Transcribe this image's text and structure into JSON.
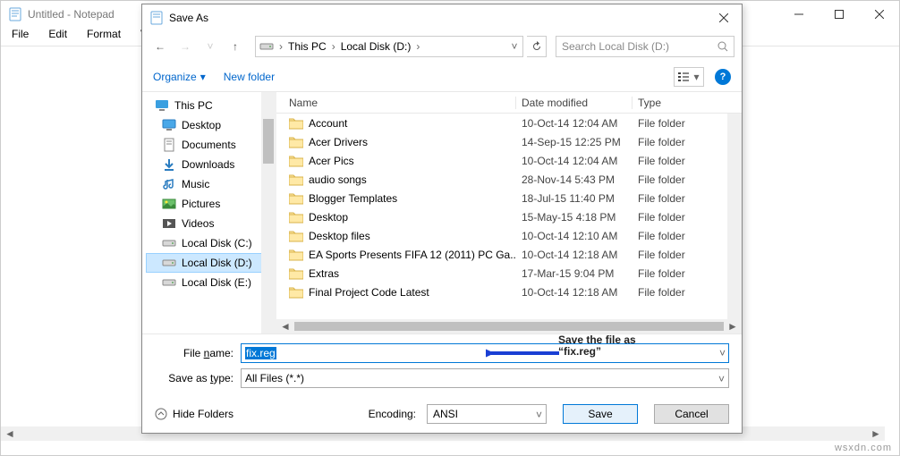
{
  "notepad": {
    "title": "Untitled - Notepad",
    "menu": {
      "file": "File",
      "edit": "Edit",
      "format": "Format",
      "view": "View"
    }
  },
  "dialog": {
    "title": "Save As",
    "breadcrumbs": {
      "root": "This PC",
      "drive": "Local Disk (D:)"
    },
    "search_placeholder": "Search Local Disk (D:)",
    "toolbar": {
      "organize": "Organize",
      "newfolder": "New folder"
    },
    "tree": [
      {
        "label": "This PC",
        "icon": "monitor",
        "top": true
      },
      {
        "label": "Desktop",
        "icon": "desktop"
      },
      {
        "label": "Documents",
        "icon": "documents"
      },
      {
        "label": "Downloads",
        "icon": "downloads"
      },
      {
        "label": "Music",
        "icon": "music"
      },
      {
        "label": "Pictures",
        "icon": "pictures"
      },
      {
        "label": "Videos",
        "icon": "videos"
      },
      {
        "label": "Local Disk (C:)",
        "icon": "disk"
      },
      {
        "label": "Local Disk (D:)",
        "icon": "disk",
        "selected": true
      },
      {
        "label": "Local Disk (E:)",
        "icon": "disk"
      }
    ],
    "columns": {
      "name": "Name",
      "date": "Date modified",
      "type": "Type"
    },
    "files": [
      {
        "name": "Account",
        "date": "10-Oct-14 12:04 AM",
        "type": "File folder"
      },
      {
        "name": "Acer Drivers",
        "date": "14-Sep-15 12:25 PM",
        "type": "File folder"
      },
      {
        "name": "Acer Pics",
        "date": "10-Oct-14 12:04 AM",
        "type": "File folder"
      },
      {
        "name": "audio songs",
        "date": "28-Nov-14 5:43 PM",
        "type": "File folder"
      },
      {
        "name": "Blogger Templates",
        "date": "18-Jul-15 11:40 PM",
        "type": "File folder"
      },
      {
        "name": "Desktop",
        "date": "15-May-15 4:18 PM",
        "type": "File folder"
      },
      {
        "name": "Desktop files",
        "date": "10-Oct-14 12:10 AM",
        "type": "File folder"
      },
      {
        "name": "EA Sports Presents FIFA 12 (2011) PC Ga...",
        "date": "10-Oct-14 12:18 AM",
        "type": "File folder"
      },
      {
        "name": "Extras",
        "date": "17-Mar-15 9:04 PM",
        "type": "File folder"
      },
      {
        "name": "Final Project Code Latest",
        "date": "10-Oct-14 12:18 AM",
        "type": "File folder"
      }
    ],
    "form": {
      "filename_label_pre": "File ",
      "filename_label_ul": "n",
      "filename_label_post": "ame:",
      "filename_value": "fix.reg",
      "type_label_pre": "Save as ",
      "type_label_ul": "t",
      "type_label_post": "ype:",
      "type_value": "All Files  (*.*)",
      "encoding_label": "Encoding:",
      "encoding_value": "ANSI",
      "hide_folders": "Hide Folders",
      "save": "Save",
      "save_ul": "S",
      "cancel": "Cancel"
    }
  },
  "annotation": {
    "line1": "Save the file as",
    "line2": "“fix.reg”"
  },
  "watermark": "wsxdn.com"
}
